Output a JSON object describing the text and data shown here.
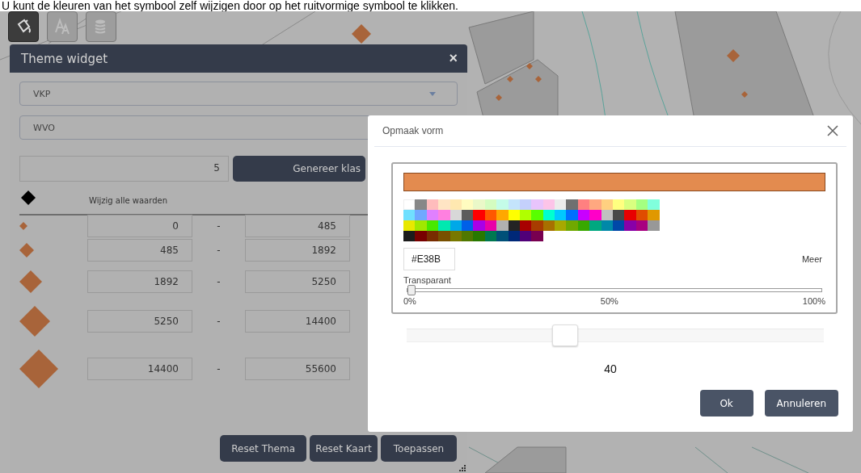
{
  "caption": "U kunt de kleuren van het symbool zelf wijzigen door op het ruitvormige symbool te klikken.",
  "toolbar": [
    {
      "kind": "style",
      "selected": true
    },
    {
      "kind": "label",
      "selected": false
    },
    {
      "kind": "data",
      "selected": false
    }
  ],
  "theme_widget": {
    "title": "Theme widget",
    "close": "×",
    "layer_select": {
      "value": "VKP"
    },
    "field_select": {
      "value": "WVO"
    },
    "class_count": "5",
    "generate_button": "Genereer klas",
    "edit_all_label": "Wijzig alle waarden",
    "classes": [
      {
        "kind": "tiny",
        "from": "0",
        "separator": "-",
        "to": "485"
      },
      {
        "kind": "small",
        "from": "485",
        "separator": "-",
        "to": "1892"
      },
      {
        "kind": "medium",
        "from": "1892",
        "separator": "-",
        "to": "5250"
      },
      {
        "kind": "large",
        "from": "5250",
        "separator": "-",
        "to": "14400"
      },
      {
        "kind": "huge",
        "from": "14400",
        "separator": "-",
        "to": "55600"
      }
    ],
    "buttons": [
      "Reset Thema",
      "Reset Kaart",
      "Toepassen"
    ]
  },
  "dialog": {
    "title": "Opmaak vorm",
    "preview": {
      "color": "#e38b4f"
    },
    "swatch_rows": [
      [
        {
          "color": "#ffffff"
        },
        {
          "color": "#888888"
        },
        {
          "color": "#ffbcbc"
        },
        {
          "color": "#ffe4c4"
        },
        {
          "color": "#ffe8b0"
        },
        {
          "color": "#fffcc0"
        },
        {
          "color": "#eaf8c8"
        },
        {
          "color": "#d4fcc0"
        },
        {
          "color": "#c4fce8"
        },
        {
          "color": "#c4e4fc"
        },
        {
          "color": "#c4d0fc"
        },
        {
          "color": "#e8c4fc"
        },
        {
          "color": "#fcc4e8"
        },
        {
          "color": "#ebebeb"
        },
        {
          "color": "#707070"
        },
        {
          "color": "#ff8080"
        },
        {
          "color": "#ffa880"
        },
        {
          "color": "#ffd080"
        },
        {
          "color": "#ffff80"
        },
        {
          "color": "#d8ff80"
        },
        {
          "color": "#a4ff80"
        },
        {
          "color": "#80ffdc"
        }
      ],
      [
        {
          "color": "#70e0ff"
        },
        {
          "color": "#70a8ff"
        },
        {
          "color": "#e080ff"
        },
        {
          "color": "#ff80e0"
        },
        {
          "color": "#d8d8d8"
        },
        {
          "color": "#5c5c5c"
        },
        {
          "color": "#ff0000"
        },
        {
          "color": "#ff5800"
        },
        {
          "color": "#ffa800"
        },
        {
          "color": "#ffff00"
        },
        {
          "color": "#b0ff00"
        },
        {
          "color": "#58ff00"
        },
        {
          "color": "#00ffd0"
        },
        {
          "color": "#00c8ff"
        },
        {
          "color": "#0070ff"
        },
        {
          "color": "#c800ff"
        },
        {
          "color": "#ff00c8"
        },
        {
          "color": "#c0c0c0"
        },
        {
          "color": "#484848"
        },
        {
          "color": "#e80000"
        },
        {
          "color": "#e04c00"
        },
        {
          "color": "#e09800"
        }
      ],
      [
        {
          "color": "#e8e800"
        },
        {
          "color": "#a0e800"
        },
        {
          "color": "#48e800"
        },
        {
          "color": "#00e8b0"
        },
        {
          "color": "#00a8e8"
        },
        {
          "color": "#0060e8"
        },
        {
          "color": "#a800e8"
        },
        {
          "color": "#e800a8"
        },
        {
          "color": "#b0b0b0"
        },
        {
          "color": "#242424"
        },
        {
          "color": "#a80000"
        },
        {
          "color": "#a83c00"
        },
        {
          "color": "#a87000"
        },
        {
          "color": "#a8a800"
        },
        {
          "color": "#70a800"
        },
        {
          "color": "#38a800"
        },
        {
          "color": "#00a880"
        },
        {
          "color": "#0088a8"
        },
        {
          "color": "#0048a8"
        },
        {
          "color": "#8800a8"
        },
        {
          "color": "#a80080"
        },
        {
          "color": "#989898"
        }
      ],
      [
        {
          "color": "#1c1c1c"
        },
        {
          "color": "#780000"
        },
        {
          "color": "#782c00"
        },
        {
          "color": "#785000"
        },
        {
          "color": "#787800"
        },
        {
          "color": "#507800"
        },
        {
          "color": "#287800"
        },
        {
          "color": "#007850"
        },
        {
          "color": "#005078"
        },
        {
          "color": "#002878"
        },
        {
          "color": "#500078"
        },
        {
          "color": "#780050"
        }
      ]
    ],
    "hex_value": "#E38B",
    "more_link": "Meer",
    "transparency": {
      "label": "Transparant",
      "level": 0,
      "ticks": [
        "0%",
        "50%",
        "100%"
      ]
    },
    "size_slider": {
      "level": 0.377,
      "value": "40"
    },
    "buttons": [
      "Ok",
      "Annuleren"
    ]
  }
}
